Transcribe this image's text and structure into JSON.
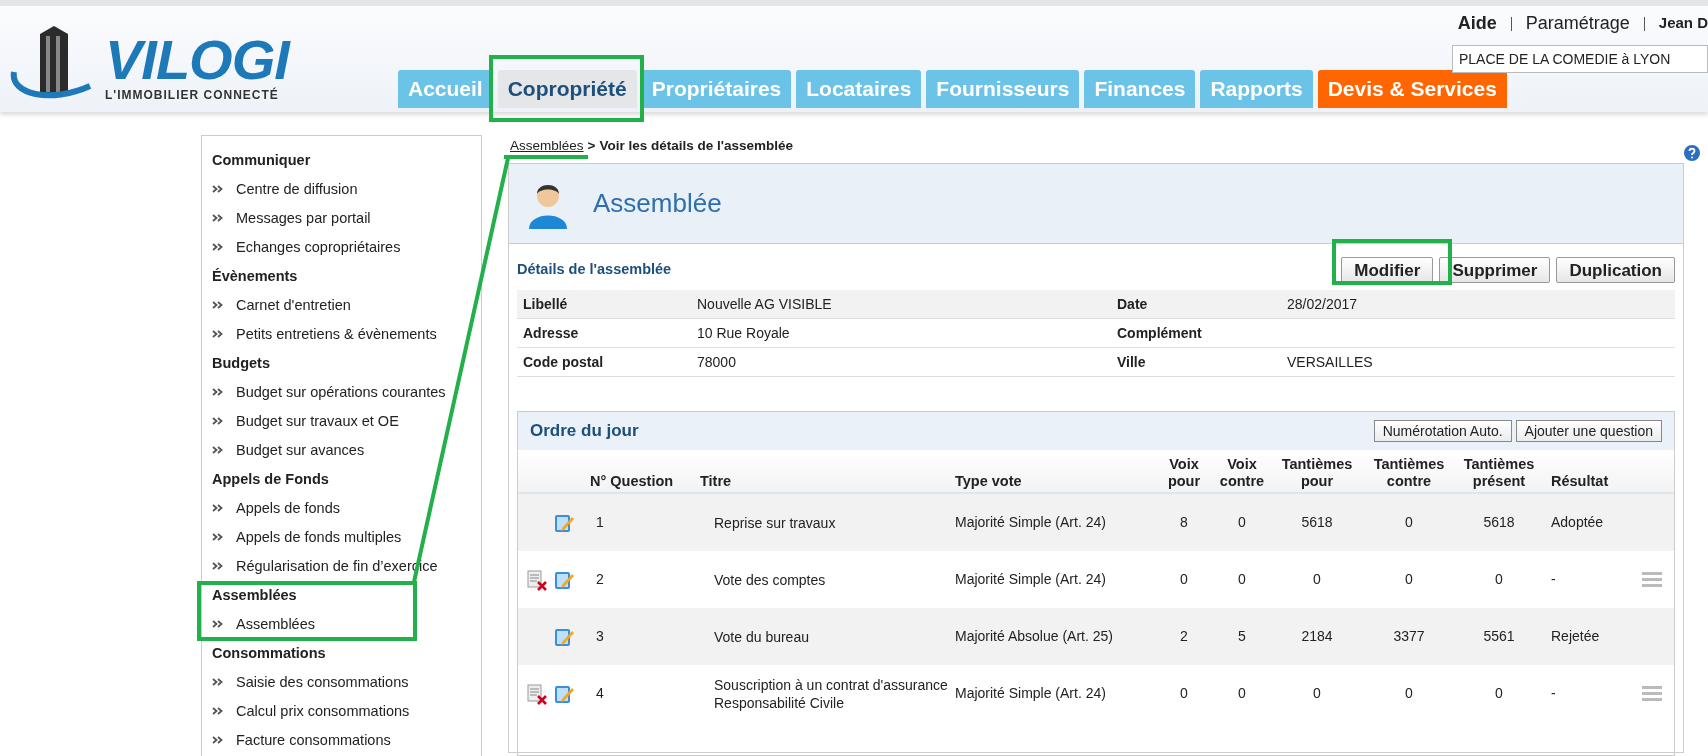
{
  "header": {
    "logo": {
      "name": "VILOGI",
      "tagline": "L'IMMOBILIER CONNECTÉ"
    },
    "links": [
      "Aide",
      "Paramétrage",
      "Jean D"
    ],
    "residence_field": {
      "value": "PLACE DE LA COMEDIE à LYON"
    }
  },
  "tabs": [
    {
      "label": "Accueil",
      "selected": false,
      "kind": "standard"
    },
    {
      "label": "Copropriété",
      "selected": true,
      "kind": "standard"
    },
    {
      "label": "Propriétaires",
      "selected": false,
      "kind": "standard"
    },
    {
      "label": "Locataires",
      "selected": false,
      "kind": "standard"
    },
    {
      "label": "Fournisseurs",
      "selected": false,
      "kind": "standard"
    },
    {
      "label": "Finances",
      "selected": false,
      "kind": "standard"
    },
    {
      "label": "Rapports",
      "selected": false,
      "kind": "standard"
    },
    {
      "label": "Devis & Services",
      "selected": false,
      "kind": "promo"
    }
  ],
  "sidebar": {
    "sections": [
      {
        "title": "Communiquer",
        "items": [
          "Centre de diffusion",
          "Messages par portail",
          "Echanges copropriétaires"
        ]
      },
      {
        "title": "Évènements",
        "items": [
          "Carnet d'entretien",
          "Petits entretiens & évènements"
        ]
      },
      {
        "title": "Budgets",
        "items": [
          "Budget sur opérations courantes",
          "Budget sur travaux et OE",
          "Budget sur avances"
        ]
      },
      {
        "title": "Appels de Fonds",
        "items": [
          "Appels de fonds",
          "Appels de fonds multiples",
          "Régularisation de fin d’exercice"
        ]
      },
      {
        "title": "Assemblées",
        "items": [
          "Assemblées"
        ]
      },
      {
        "title": "Consommations",
        "items": [
          "Saisie des consommations",
          "Calcul prix consommations",
          "Facture consommations"
        ]
      }
    ]
  },
  "breadcrumb": {
    "link": "Assemblées",
    "separator": ">",
    "current": "Voir les détails de l'assemblée"
  },
  "page_title": "Assemblée",
  "details": {
    "title": "Détails de l'assemblée",
    "buttons": [
      "Modifier",
      "Supprimer",
      "Duplication"
    ],
    "rows": [
      [
        {
          "label": "Libellé",
          "value": "Nouvelle AG VISIBLE"
        },
        {
          "label": "Date",
          "value": "28/02/2017"
        }
      ],
      [
        {
          "label": "Adresse",
          "value": "10 Rue Royale"
        },
        {
          "label": "Complément"
        }
      ],
      [
        {
          "label": "Code postal",
          "value": "78000"
        },
        {
          "label": "Ville",
          "value": "VERSAILLES"
        }
      ]
    ]
  },
  "agenda": {
    "title": "Ordre du jour",
    "buttons": [
      "Numérotation Auto.",
      "Ajouter une question"
    ],
    "columns": [
      "N° Question",
      "Titre",
      "Type vote",
      "Voix pour",
      "Voix contre",
      "Tantièmes pour",
      "Tantièmes contre",
      "Tantièmes présent",
      "Résultat"
    ],
    "rows": [
      {
        "deletable": false,
        "cells": [
          "1",
          "Reprise sur travaux",
          "Majorité Simple (Art. 24)",
          "8",
          "0",
          "5618",
          "0",
          "5618",
          "Adoptée"
        ]
      },
      {
        "deletable": true,
        "cells": [
          "2",
          "Vote des comptes",
          "Majorité Simple (Art. 24)",
          "0",
          "0",
          "0",
          "0",
          "0",
          "-"
        ]
      },
      {
        "deletable": false,
        "cells": [
          "3",
          "Vote du bureau",
          "Majorité Absolue (Art. 25)",
          "2",
          "5",
          "2184",
          "3377",
          "5561",
          "Rejetée"
        ]
      },
      {
        "deletable": true,
        "cells": [
          "4",
          "Souscription à un contrat d'assurance Responsabilité Civile",
          "Majorité Simple (Art. 24)",
          "0",
          "0",
          "0",
          "0",
          "0",
          "-"
        ]
      }
    ]
  }
}
